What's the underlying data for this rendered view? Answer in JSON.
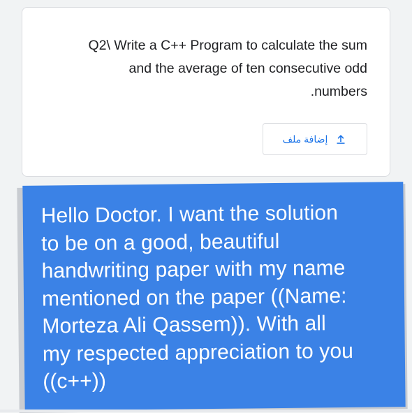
{
  "question": {
    "lines": [
      "Q2\\ Write a C++ Program to calculate the sum",
      "and the average of ten consecutive odd",
      ".numbers"
    ]
  },
  "attach": {
    "label": "إضافة ملف",
    "icon": "upload-icon"
  },
  "note": {
    "text": "Hello Doctor.  I want the solution\nto be on a good, beautiful\nhandwriting paper with my name\nmentioned on the paper ((Name:\nMorteza Ali Qassem)).  With all\nmy respected appreciation to you\n((c++))",
    "background": "#3b82e6",
    "text_color": "#ffffff"
  },
  "colors": {
    "accent": "#1a73e8",
    "page_background": "#f1f3f4",
    "card_border": "#dadce0"
  }
}
